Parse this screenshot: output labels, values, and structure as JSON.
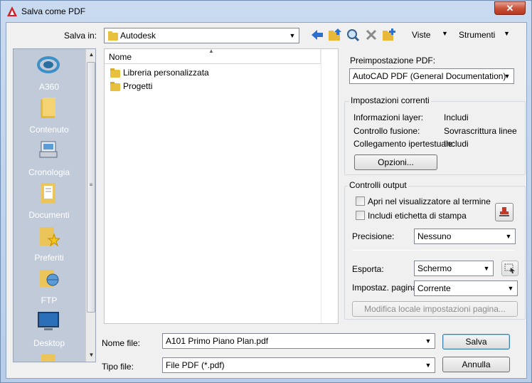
{
  "window": {
    "title": "Salva come PDF",
    "close_label": "✕"
  },
  "toolbar": {
    "save_in_label": "Salva in:",
    "save_in_value": "Autodesk",
    "views_label": "Viste",
    "tools_label": "Strumenti",
    "icons": [
      "back-arrow-icon",
      "up-folder-icon",
      "search-web-icon",
      "delete-icon",
      "new-folder-icon"
    ]
  },
  "places": [
    {
      "label": "A360",
      "icon": "a360-icon"
    },
    {
      "label": "Contenuto",
      "icon": "folder-icon"
    },
    {
      "label": "Cronologia",
      "icon": "history-icon"
    },
    {
      "label": "Documenti",
      "icon": "documents-icon"
    },
    {
      "label": "Preferiti",
      "icon": "favorites-icon"
    },
    {
      "label": "FTP",
      "icon": "ftp-icon"
    },
    {
      "label": "Desktop",
      "icon": "desktop-icon"
    }
  ],
  "filelist": {
    "column_header": "Nome",
    "items": [
      {
        "name": "Libreria personalizzata",
        "icon": "folder-icon"
      },
      {
        "name": "Progetti",
        "icon": "folder-icon"
      }
    ]
  },
  "pdf_preset": {
    "label": "Preimpostazione PDF:",
    "value": "AutoCAD PDF (General Documentation)"
  },
  "current_settings": {
    "title": "Impostazioni correnti",
    "rows": [
      {
        "key": "Informazioni layer:",
        "value": "Includi"
      },
      {
        "key": "Controllo fusione:",
        "value": "Sovrascrittura linee"
      },
      {
        "key": "Collegamento ipertestuale:",
        "value": "Includi"
      }
    ],
    "options_button": "Opzioni..."
  },
  "output_controls": {
    "title": "Controlli output",
    "open_in_viewer": "Apri nel visualizzatore al termine",
    "include_stamp": "Includi etichetta di stampa",
    "precision_label": "Precisione:",
    "precision_value": "Nessuno",
    "export_label": "Esporta:",
    "export_value": "Schermo",
    "page_setup_label": "Impostaz. pagina:",
    "page_setup_value": "Corrente",
    "modify_page_setup_button": "Modifica locale impostazioni pagina..."
  },
  "footer": {
    "filename_label": "Nome file:",
    "filename_value": "A101 Primo Piano Plan.pdf",
    "filetype_label": "Tipo file:",
    "filetype_value": "File PDF (*.pdf)",
    "save_button": "Salva",
    "cancel_button": "Annulla"
  }
}
